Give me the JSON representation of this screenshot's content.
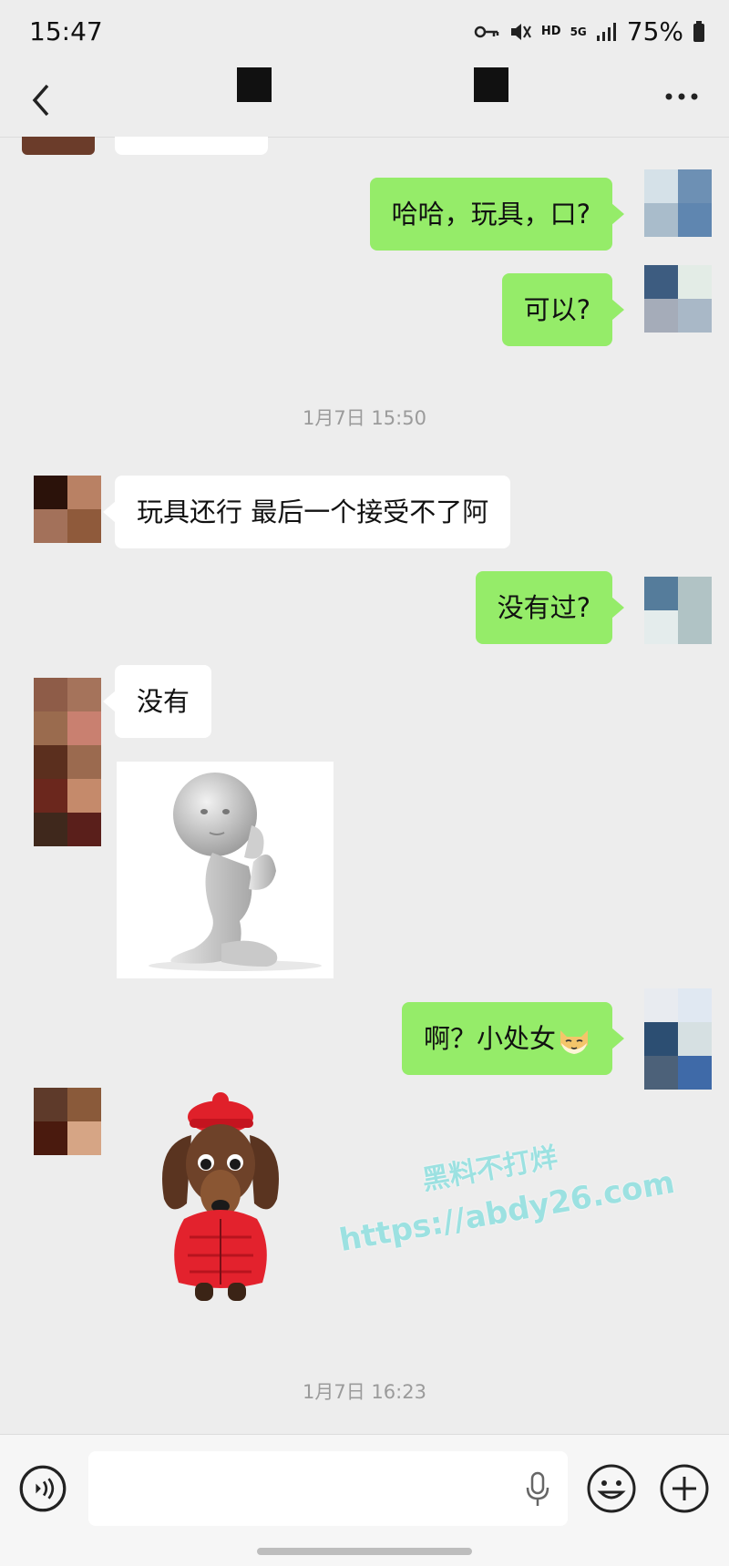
{
  "status_bar": {
    "time": "15:47",
    "network": "HD",
    "network_gen": "5G",
    "battery": "75%"
  },
  "header": {
    "back_icon": "chevron-left-icon",
    "more_icon": "more-dots-icon"
  },
  "messages": [
    {
      "side": "out",
      "text": "哈哈，玩具，口?"
    },
    {
      "side": "out",
      "text": "可以?"
    },
    {
      "type": "timestamp",
      "text": "1月7日 15:50"
    },
    {
      "side": "in",
      "text": "玩具还行 最后一个接受不了阿"
    },
    {
      "side": "out",
      "text": "没有过?"
    },
    {
      "side": "in",
      "text": "没有"
    },
    {
      "side": "in",
      "type": "sticker",
      "name": "kneeling-figure-sticker"
    },
    {
      "side": "out",
      "text": "啊？小处女",
      "emoji": "cat-face-icon"
    },
    {
      "side": "in",
      "type": "sticker",
      "name": "dog-in-red-jacket-sticker"
    },
    {
      "type": "timestamp",
      "text": "1月7日 16:23"
    }
  ],
  "watermark": {
    "line1": "黑料不打烊",
    "line2": "https://abdy26.com"
  },
  "input_bar": {
    "voice_icon": "voice-toggle-icon",
    "mic_icon": "microphone-icon",
    "emoji_icon": "emoji-icon",
    "plus_icon": "plus-icon"
  },
  "colors": {
    "outgoing_bubble": "#95ec69",
    "incoming_bubble": "#ffffff",
    "background": "#ededed"
  }
}
